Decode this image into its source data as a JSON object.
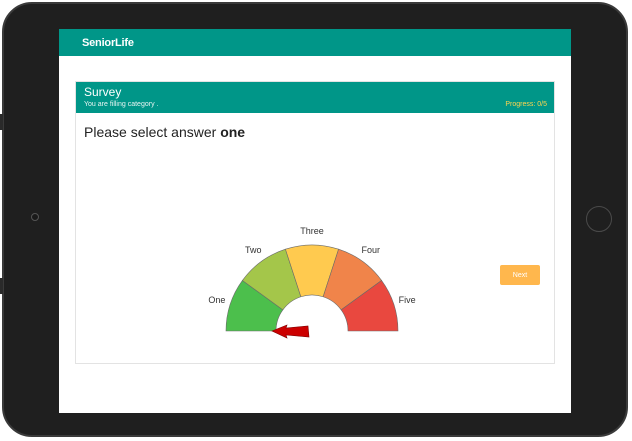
{
  "app": {
    "brand": "SeniorLife"
  },
  "survey": {
    "title": "Survey",
    "subtitle": "You are filling category .",
    "progress": "Progress: 0/5",
    "question_prefix": "Please select answer",
    "question_target": "one",
    "next_label": "Next"
  },
  "gauge": {
    "options": [
      "One",
      "Two",
      "Three",
      "Four",
      "Five"
    ],
    "colors": [
      "#4cbf4c",
      "#a4c64a",
      "#ffca4f",
      "#f0844a",
      "#e9483f"
    ],
    "pointer_color": "#cc0000",
    "selected_level": 0
  },
  "colors": {
    "accent": "#009688",
    "button": "#ffb74d",
    "progress": "#ffd54f"
  }
}
